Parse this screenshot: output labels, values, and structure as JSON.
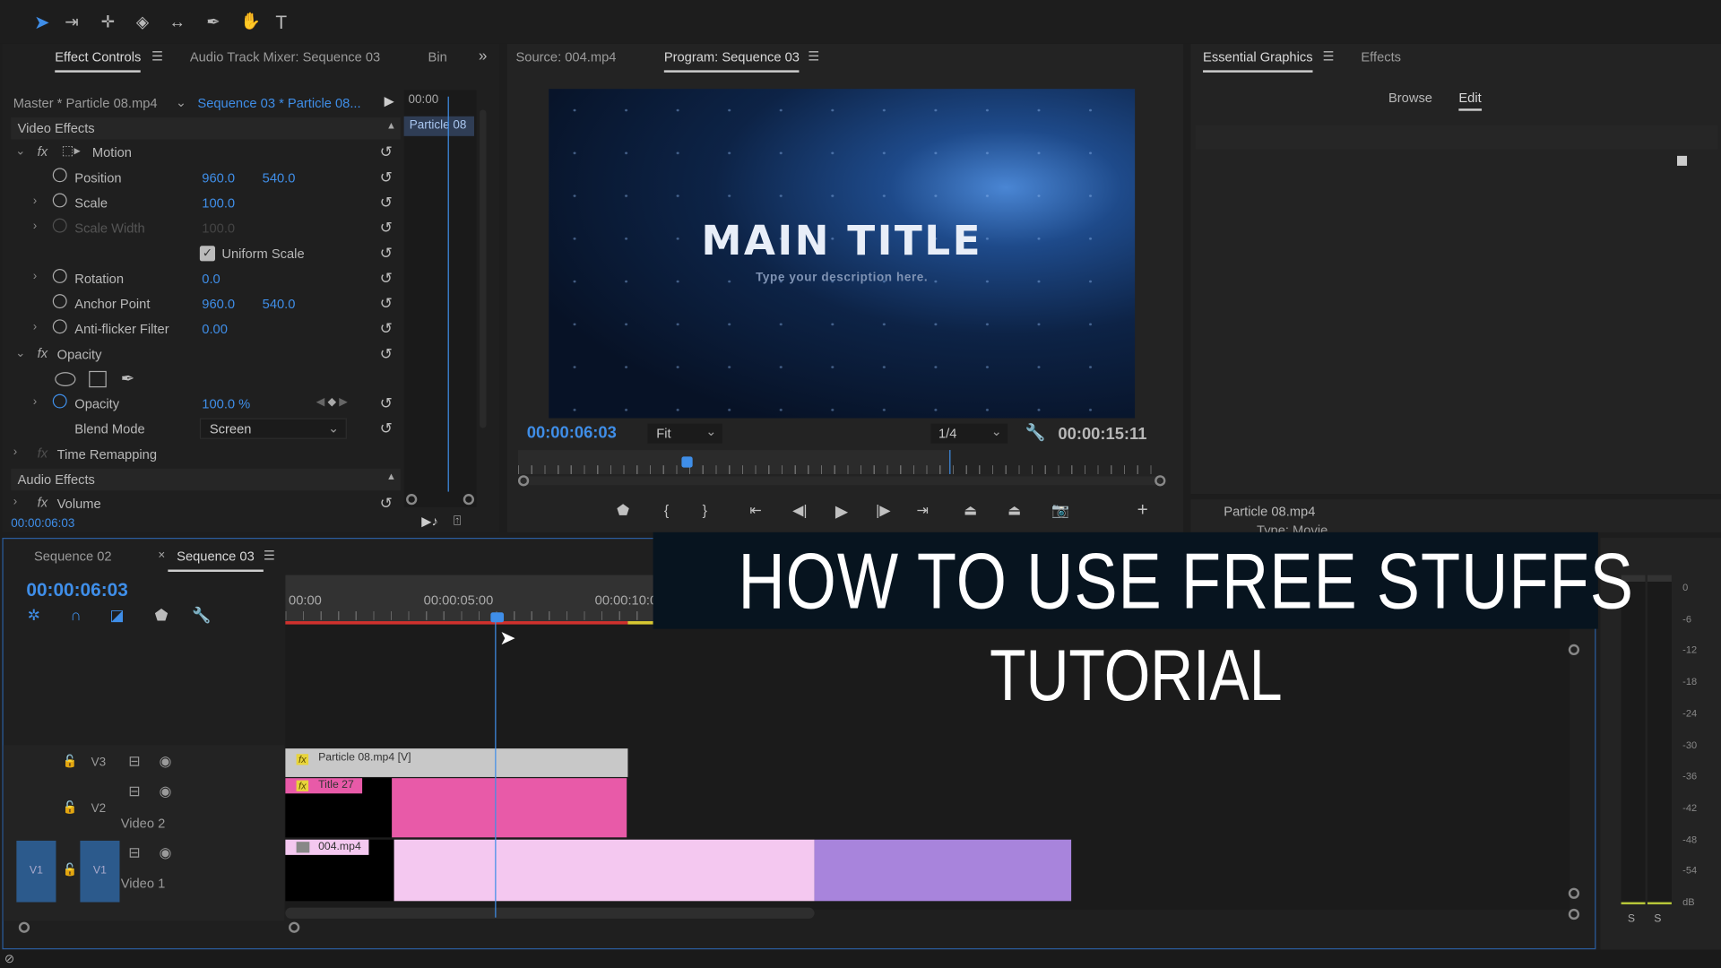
{
  "toolbar": {
    "tools": [
      "selection-tool",
      "track-select-tool",
      "ripple-edit-tool",
      "razor-tool",
      "slip-tool",
      "pen-tool",
      "hand-tool",
      "type-tool"
    ]
  },
  "effect_controls": {
    "tabs": [
      "Effect Controls",
      "Audio Track Mixer: Sequence 03",
      "Bin"
    ],
    "master": "Master * Particle 08.mp4",
    "sequence": "Sequence 03 * Particle 08...",
    "mini_timecode": "00:00",
    "mini_clip": "Particle 08",
    "video_effects": "Video Effects",
    "motion": "Motion",
    "position": {
      "label": "Position",
      "x": "960.0",
      "y": "540.0"
    },
    "scale": {
      "label": "Scale",
      "value": "100.0"
    },
    "scale_width": {
      "label": "Scale Width",
      "value": "100.0"
    },
    "uniform_scale": "Uniform Scale",
    "rotation": {
      "label": "Rotation",
      "value": "0.0"
    },
    "anchor": {
      "label": "Anchor Point",
      "x": "960.0",
      "y": "540.0"
    },
    "antiflicker": {
      "label": "Anti-flicker Filter",
      "value": "0.00"
    },
    "opacity_group": "Opacity",
    "opacity": {
      "label": "Opacity",
      "value": "100.0 %"
    },
    "blend": {
      "label": "Blend Mode",
      "value": "Screen"
    },
    "time_remap": "Time Remapping",
    "audio_effects": "Audio Effects",
    "volume": "Volume",
    "timecode": "00:00:06:03",
    "uniform_scale_checked": true
  },
  "monitor": {
    "tabs": [
      "Source: 004.mp4",
      "Program: Sequence 03"
    ],
    "title": "MAIN TITLE",
    "description": "Type your description here.",
    "timecode": "00:00:06:03",
    "fit": "Fit",
    "resolution": "1/4",
    "duration": "00:00:15:11",
    "playhead_fraction": 0.39
  },
  "essential_graphics": {
    "tabs": [
      "Essential Graphics",
      "Effects"
    ],
    "browse": "Browse",
    "edit": "Edit",
    "clip_name": "Particle 08.mp4",
    "type": "Type:  Movie"
  },
  "timeline": {
    "tabs": [
      "Sequence 02",
      "Sequence 03"
    ],
    "timecode": "00:00:06:03",
    "ruler": [
      "00:00",
      "00:00:05:00",
      "00:00:10:0"
    ],
    "tracks": [
      {
        "id": "V3",
        "name": ""
      },
      {
        "id": "V2",
        "name": "Video 2"
      },
      {
        "id": "V1",
        "name": "Video 1",
        "source": "V1"
      }
    ],
    "clips": {
      "v3": "Particle 08.mp4 [V]",
      "v2": "Title 27",
      "v1": "004.mp4",
      "fx": "fx"
    }
  },
  "overlay": {
    "line1": "HOW TO USE FREE STUFFS",
    "line2": "TUTORIAL"
  },
  "meter": {
    "labels": [
      "0",
      "-6",
      "-12",
      "-18",
      "-24",
      "-30",
      "-36",
      "-42",
      "-48",
      "-54",
      "dB"
    ],
    "solo": [
      "S",
      "S"
    ]
  },
  "colors": {
    "accent": "#3f8ee8",
    "title_clip": "#e85aa8",
    "video_clip_light": "#f4c8f0",
    "video_clip_purple": "#a884dc",
    "work_area": "#d0312d"
  }
}
